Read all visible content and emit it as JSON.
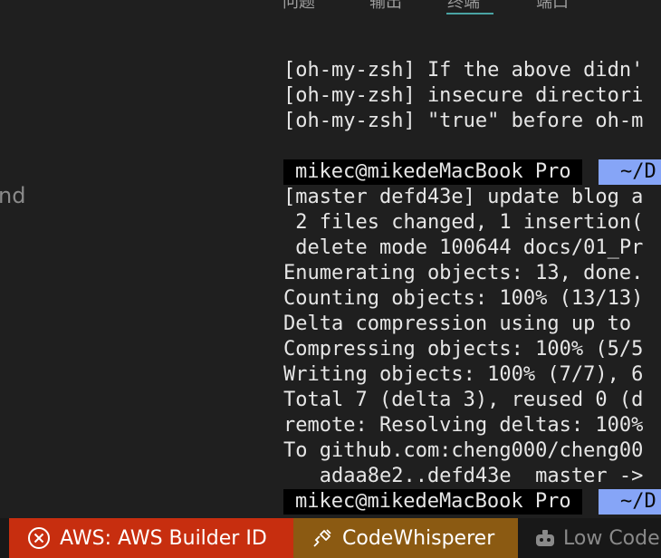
{
  "sidebar": {
    "partial_text": "nd"
  },
  "tabs": [
    {
      "label": "问题"
    },
    {
      "label": "输出"
    },
    {
      "label": "终端"
    },
    {
      "label": "端口"
    }
  ],
  "terminal": {
    "warning_lines": [
      "[oh-my-zsh] If the above didn'",
      "[oh-my-zsh] insecure directori",
      "[oh-my-zsh] \"true\" before oh-m"
    ],
    "prompts": [
      {
        "user_host": "mikec@mikedeMacBook-Pro",
        "path": "~/D",
        "state": "completed"
      },
      {
        "user_host": "mikec@mikedeMacBook-Pro",
        "path": "~/D",
        "state": "pending"
      }
    ],
    "output_lines": [
      "[master defd43e] update blog a",
      " 2 files changed, 1 insertion(",
      " delete mode 100644 docs/01_Pr",
      "Enumerating objects: 13, done.",
      "Counting objects: 100% (13/13)",
      "Delta compression using up to ",
      "Compressing objects: 100% (5/5",
      "Writing objects: 100% (7/7), 6",
      "Total 7 (delta 3), reused 0 (d",
      "remote: Resolving deltas: 100%",
      "To github.com:cheng000/cheng00",
      "   adaa8e2..defd43e  master ->"
    ]
  },
  "statusbar": {
    "aws_label": "AWS: AWS Builder ID",
    "codewhisperer_label": "CodeWhisperer",
    "lowcode_label": "Low Code"
  },
  "colors": {
    "aws_bg": "#c72e0f",
    "codewhisperer_bg": "#8b5a12",
    "prompt_path_bg": "#86a5f7",
    "decoration_success": "#1a85c7"
  }
}
